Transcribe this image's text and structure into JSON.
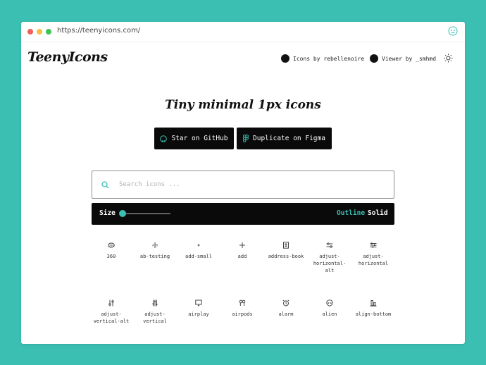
{
  "browser": {
    "url": "https://teenyicons.com/"
  },
  "header": {
    "logo": "TeenyIcons",
    "credit_icons": "Icons by rebellenoire",
    "credit_viewer": "Viewer by _smhmd"
  },
  "hero": {
    "tagline": "Tiny minimal 1px icons",
    "github_button": "Star on GitHub",
    "figma_button": "Duplicate on Figma"
  },
  "search": {
    "placeholder": "Search icons ..."
  },
  "controls": {
    "size_label": "Size",
    "outline_label": "Outline",
    "solid_label": "Solid",
    "selected_style": "Outline",
    "size_slider_fraction": 0.0
  },
  "icons_row1": [
    "360",
    "ab-testing",
    "add-small",
    "add",
    "address-book",
    "adjust-\nhorizontal-\nalt",
    "adjust-\nhorizontal"
  ],
  "icons_row2": [
    "adjust-\nvertical-alt",
    "adjust-\nvertical",
    "airplay",
    "airpods",
    "alarm",
    "alien",
    "align-bottom"
  ],
  "colors": {
    "accent": "#3bbfb3",
    "button_bg": "#0a0a0a"
  }
}
